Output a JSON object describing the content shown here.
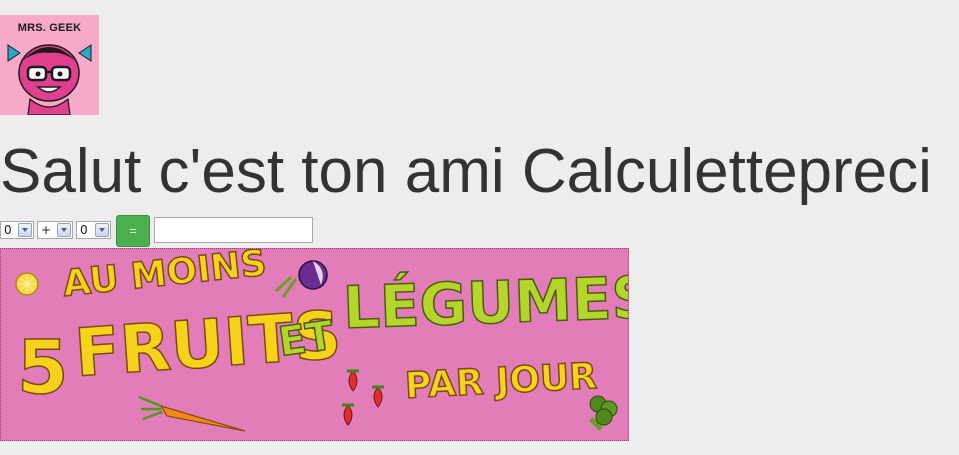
{
  "logo": {
    "text": "MRS. GEEK",
    "icon": "mrs-geek-character"
  },
  "page": {
    "title": "Salut c'est ton ami Calculettepreci"
  },
  "calculator": {
    "operand_a": "0",
    "operator": "+",
    "operand_b": "0",
    "equals_label": "=",
    "result_value": ""
  },
  "banner": {
    "line1": "AU MOINS",
    "line2_number": "5",
    "line2_word": "FRUITS",
    "line3": "ET",
    "line4": "LÉGUMES",
    "line5": "PAR JOUR",
    "icons": [
      "lemon-icon",
      "turnip-icon",
      "strawberry-icon",
      "carrot-icon",
      "broccoli-icon"
    ]
  },
  "colors": {
    "background": "#ededed",
    "logo_background": "#f6a9c8",
    "banner_background": "#e27db9",
    "button_green": "#4caf50",
    "title_text": "#333333"
  }
}
